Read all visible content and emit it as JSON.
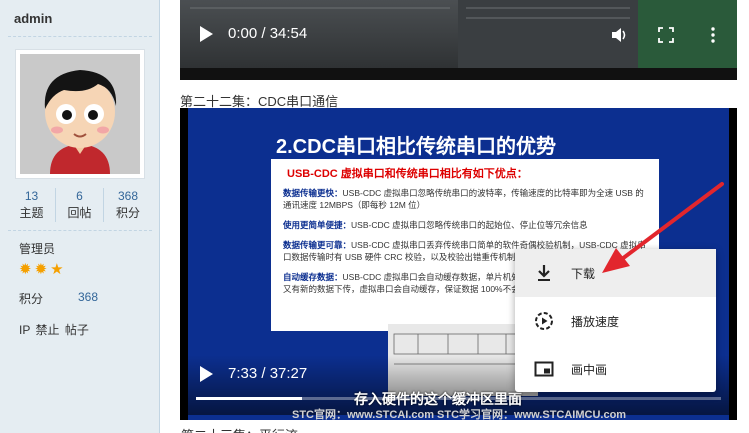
{
  "user": {
    "name": "admin",
    "stats": [
      {
        "value": "13",
        "label": "主题"
      },
      {
        "value": "6",
        "label": "回帖"
      },
      {
        "value": "368",
        "label": "积分"
      }
    ],
    "group": "管理员",
    "points_label": "积分",
    "points_value": "368",
    "admin_links": [
      "IP",
      "禁止",
      "帖子"
    ]
  },
  "video1": {
    "time": "0:00 / 34:54"
  },
  "section_title": "第二十二集：CDC串口通信",
  "video2": {
    "time": "7:33 / 37:27",
    "progress": 0.202,
    "slide_title": "2.CDC串口相比传统串口的优势",
    "slide_subtitle": "USB-CDC 虚拟串口和传统串口相比有如下优点：",
    "slide_items": [
      {
        "head": "数据传输更快：",
        "text": "USB-CDC 虚拟串口忽略传统串口的波特率，传输速度的比特率即为全速 USB 的通讯速度 12MBPS（即每秒 12M 位）"
      },
      {
        "head": "使用更简单便捷：",
        "text": "USB-CDC 虚拟串口忽略传统串口的起始位、停止位等冗余信息"
      },
      {
        "head": "数据传输更可靠：",
        "text": "USB-CDC 虚拟串口丢弃传统串口简单的软件奇偶校验机制，USB-CDC 虚拟串口数据传输时有 USB 硬件 CRC 校验，以及校验出错重传机制"
      },
      {
        "head": "自动缓存数据：",
        "text": "USB-CDC 虚拟串口会自动缓存数据，单片机处理完一笔数据时，如果此时上位机又有新的数据下传，虚拟串口会自动缓存，保证数据 100%不会丢失或覆盖。"
      }
    ],
    "bottom_caption": "存入硬件的这个缓冲区里面",
    "watermark": "STC官网：www.STCAI.com    STC学习官网：www.STCAIMCU.com"
  },
  "context_menu": [
    {
      "icon": "download-icon",
      "label": "下载"
    },
    {
      "icon": "playback-speed-icon",
      "label": "播放速度"
    },
    {
      "icon": "picture-in-picture-icon",
      "label": "画中画"
    }
  ],
  "next_title": "第二十三集：平行流"
}
